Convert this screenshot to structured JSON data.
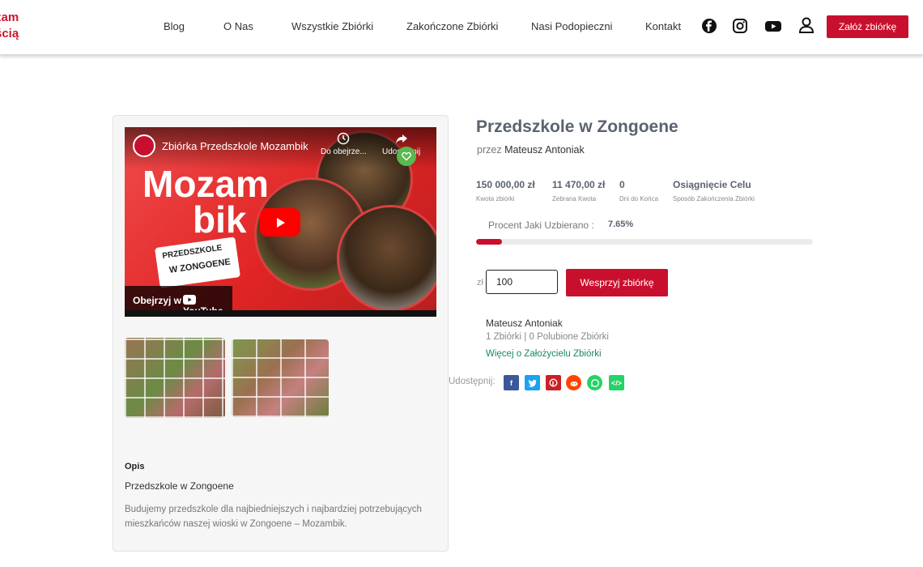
{
  "header": {
    "logo_lines": [
      "zam",
      "ścią"
    ],
    "nav": [
      "Blog",
      "O Nas",
      "Wszystkie Zbiórki",
      "Zakończone Zbiórki",
      "Nasi Podopieczni",
      "Kontakt"
    ],
    "cta_label": "Załóż zbiórkę",
    "icons": [
      "facebook-icon",
      "instagram-icon",
      "youtube-icon",
      "user-icon"
    ]
  },
  "video": {
    "title": "Zbiórka Przedszkole Mozambik",
    "big_text_1": "Mozam",
    "big_text_2": "bik",
    "badge_line_1": "PRZEDSZKOLE",
    "badge_line_2": "W ZONGOENE",
    "watch_label": "Obejrzyj w",
    "youtube_label": "YouTube",
    "later_label": "Do obejrze...",
    "share_label": "Udostępnij"
  },
  "description": {
    "label": "Opis",
    "title": "Przedszkole w Zongoene",
    "body": "Budujemy przedszkole dla najbiedniejszych i najbardziej potrzebujących mieszkańców naszej wioski w Zongoene – Mozambik."
  },
  "campaign": {
    "title": "Przedszkole w Zongoene",
    "by_prefix": "przez",
    "author": "Mateusz Antoniak",
    "stats": [
      {
        "value": "150 000,00 zł",
        "label": "Kwota zbiórki"
      },
      {
        "value": "11 470,00 zł",
        "label": "Zebrana Kwota"
      },
      {
        "value": "0",
        "label": "Dni do Końca"
      },
      {
        "value": "Osiągnięcie Celu",
        "label": "Sposób Zakończenia Zbiórki"
      }
    ],
    "percent_label": "Procent Jaki Uzbierano :",
    "percent_value": "7.65%",
    "percent_fraction": 0.0765,
    "currency": "zł",
    "amount_value": "100",
    "support_label": "Wesprzyj zbiórkę",
    "accent_color": "#c8102e"
  },
  "founder": {
    "name": "Mateusz Antoniak",
    "stats": "1 Zbiórki | 0 Polubione Zbiórki",
    "link": "Więcej o Założycielu Zbiórki"
  },
  "share": {
    "label": "Udostępnij:",
    "items": [
      {
        "icon": "facebook-share-icon",
        "glyph": "f",
        "color": "#3b5998"
      },
      {
        "icon": "twitter-share-icon",
        "glyph": "t",
        "color": "#1da1f2"
      },
      {
        "icon": "pinterest-share-icon",
        "glyph": "p",
        "color": "#cb2027"
      },
      {
        "icon": "reddit-share-icon",
        "glyph": "r",
        "color": "#ff4500"
      },
      {
        "icon": "whatsapp-share-icon",
        "glyph": "w",
        "color": "#25d366"
      },
      {
        "icon": "embed-share-icon",
        "glyph": "</>",
        "color": "#25d366"
      }
    ]
  }
}
